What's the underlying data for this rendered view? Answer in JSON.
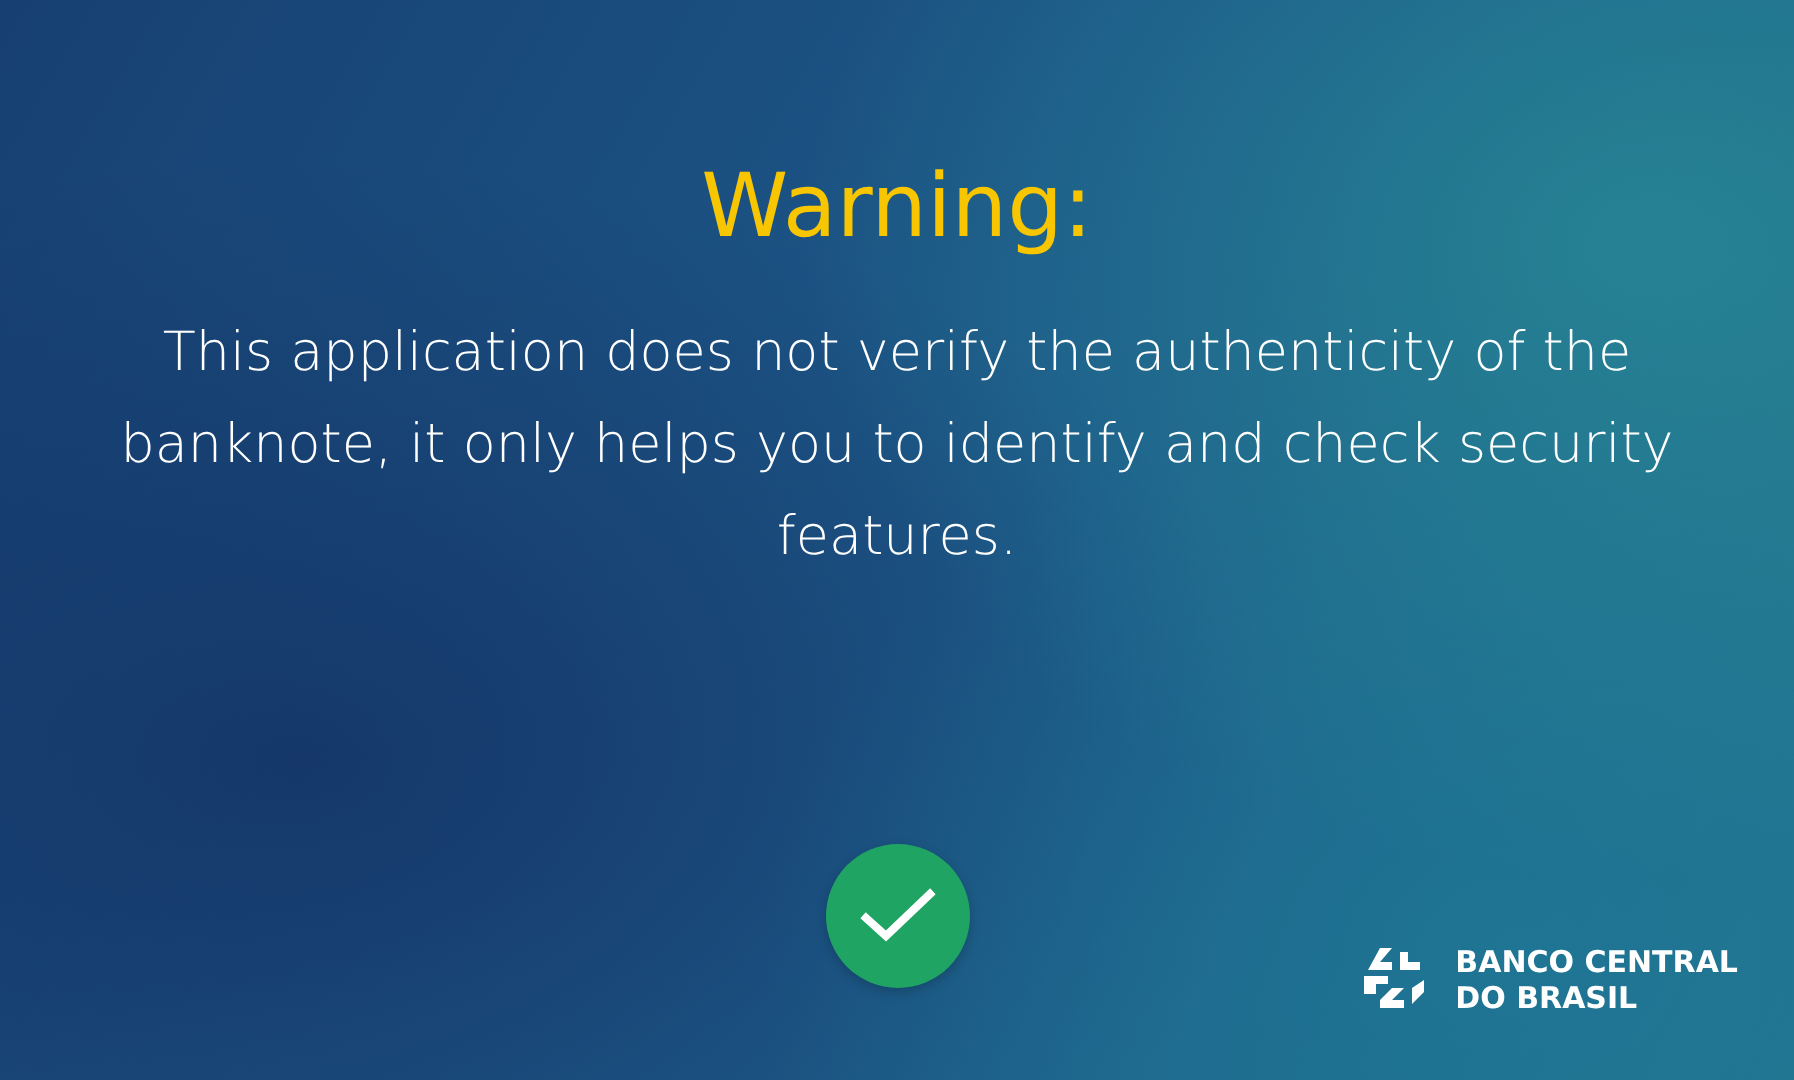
{
  "title": "Warning:",
  "message": "This application does not verify the authenticity of the banknote, it only helps you to identify and check security features.",
  "confirm_button": {
    "kind": "check"
  },
  "logo": {
    "lines": [
      "BANCO CENTRAL",
      "DO BRASIL"
    ]
  }
}
